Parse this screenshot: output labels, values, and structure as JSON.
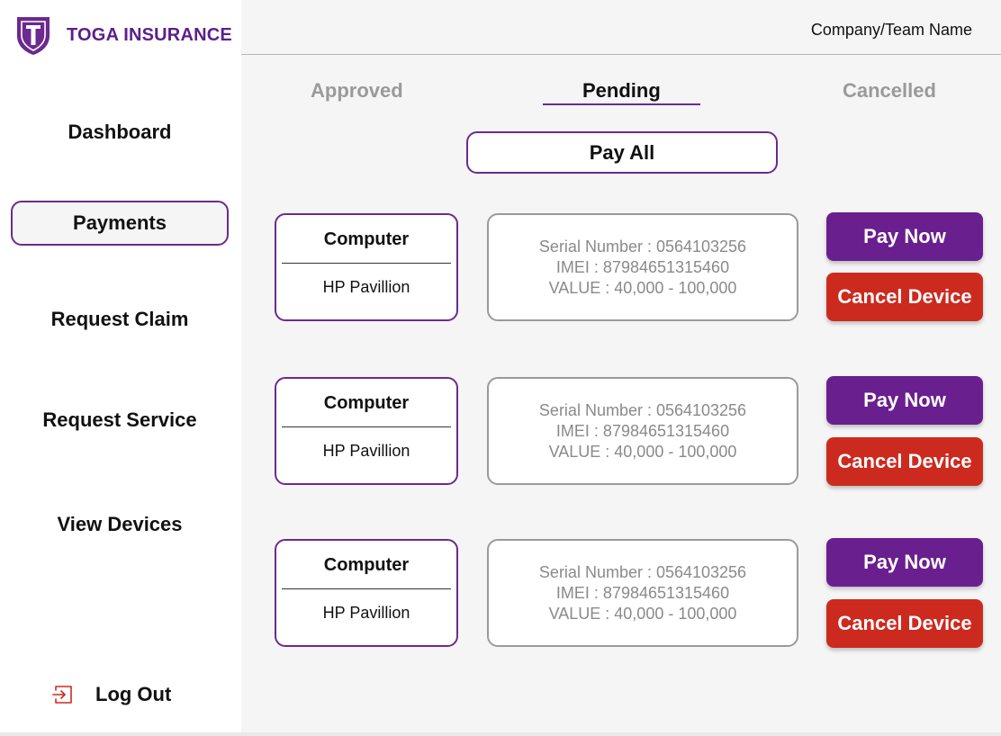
{
  "brand": {
    "name": "TOGA INSURANCE"
  },
  "colors": {
    "accent": "#6b2a8f",
    "pay": "#6a1f8e",
    "cancel": "#cc2a1f",
    "muted": "#9a9a9a"
  },
  "header": {
    "company": "Company/Team Name"
  },
  "sidebar": {
    "items": [
      {
        "label": "Dashboard",
        "active": false
      },
      {
        "label": "Payments",
        "active": true
      },
      {
        "label": "Request Claim",
        "active": false
      },
      {
        "label": "Request Service",
        "active": false
      },
      {
        "label": "View Devices",
        "active": false
      }
    ],
    "logout": {
      "label": "Log Out",
      "icon": "logout-icon"
    }
  },
  "tabs": [
    {
      "label": "Approved",
      "active": false
    },
    {
      "label": "Pending",
      "active": true
    },
    {
      "label": "Cancelled",
      "active": false
    }
  ],
  "pay_all_label": "Pay All",
  "devices": [
    {
      "type": "Computer",
      "model": "HP Pavillion",
      "serial": "Serial Number : 0564103256",
      "imei": "IMEI : 87984651315460",
      "value": "VALUE : 40,000 - 100,000",
      "pay_label": "Pay Now",
      "cancel_label": "Cancel Device"
    },
    {
      "type": "Computer",
      "model": "HP Pavillion",
      "serial": "Serial Number : 0564103256",
      "imei": "IMEI : 87984651315460",
      "value": "VALUE : 40,000 - 100,000",
      "pay_label": "Pay Now",
      "cancel_label": "Cancel Device"
    },
    {
      "type": "Computer",
      "model": "HP Pavillion",
      "serial": "Serial Number : 0564103256",
      "imei": "IMEI : 87984651315460",
      "value": "VALUE : 40,000 - 100,000",
      "pay_label": "Pay Now",
      "cancel_label": "Cancel Device"
    }
  ]
}
